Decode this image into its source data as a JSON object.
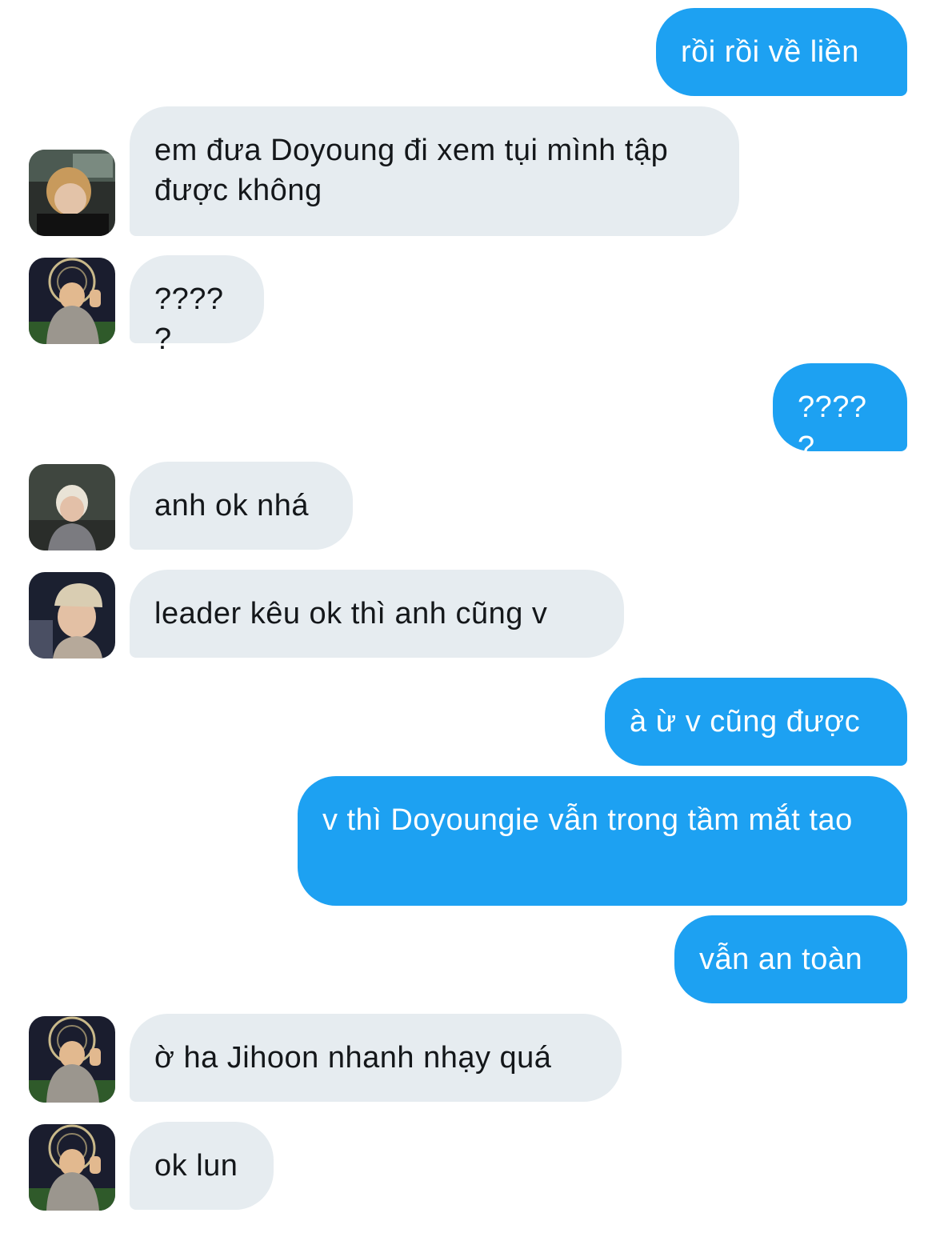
{
  "colors": {
    "outgoing_bubble": "#1da1f2",
    "incoming_bubble": "#e6ecf0",
    "outgoing_text": "#ffffff",
    "incoming_text": "#14171a"
  },
  "messages": [
    {
      "direction": "out",
      "text": "rồi rồi về liền"
    },
    {
      "direction": "in",
      "avatar": "avatar-blond-dark",
      "text": "em đưa Doyoung đi xem tụi mình tập được không"
    },
    {
      "direction": "in",
      "avatar": "avatar-ferris-wheel",
      "text": "?????"
    },
    {
      "direction": "out",
      "text": "?????"
    },
    {
      "direction": "in",
      "avatar": "avatar-silver-hair",
      "text": "anh ok nhá"
    },
    {
      "direction": "in",
      "avatar": "avatar-cap",
      "text": "leader kêu ok thì anh cũng v"
    },
    {
      "direction": "out",
      "text": "à ừ v cũng được"
    },
    {
      "direction": "out",
      "text": "v thì Doyoungie vẫn trong tầm mắt tao"
    },
    {
      "direction": "out",
      "text": "vẫn an toàn"
    },
    {
      "direction": "in",
      "avatar": "avatar-ferris-wheel",
      "text": "ờ ha Jihoon nhanh nhạy quá"
    },
    {
      "direction": "in",
      "avatar": "avatar-ferris-wheel",
      "text": "ok lun"
    }
  ]
}
